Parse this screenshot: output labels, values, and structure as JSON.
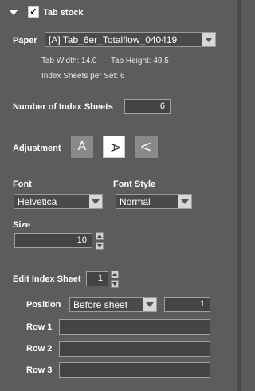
{
  "section": {
    "title": "Tab stock",
    "checked": true
  },
  "paper": {
    "label": "Paper",
    "selected": "[A] Tab_6er_Totalflow_040419",
    "tab_width": "Tab Width: 14.0",
    "tab_height": "Tab Height: 49.5",
    "index_sheets_per_set": "Index Sheets per Set: 6"
  },
  "number_of_index_sheets": {
    "label": "Number of Index Sheets",
    "value": "6"
  },
  "adjustment": {
    "label": "Adjustment",
    "options": [
      {
        "name": "adjust-normal-icon",
        "glyph": "A",
        "active": false
      },
      {
        "name": "adjust-rotate-right-icon",
        "glyph": "A",
        "active": true
      },
      {
        "name": "adjust-rotate-left-icon",
        "glyph": "A",
        "active": false
      }
    ]
  },
  "font": {
    "label": "Font",
    "selected": "Helvetica"
  },
  "font_style": {
    "label": "Font Style",
    "selected": "Normal"
  },
  "size": {
    "label": "Size",
    "value": "10"
  },
  "edit_index_sheet": {
    "label": "Edit Index Sheet",
    "value": "1"
  },
  "position": {
    "label": "Position",
    "selected": "Before sheet",
    "value": "1"
  },
  "rows": [
    {
      "label": "Row 1",
      "value": ""
    },
    {
      "label": "Row 2",
      "value": ""
    },
    {
      "label": "Row 3",
      "value": ""
    }
  ],
  "colors": {
    "background": "#5c5c5c",
    "active_button": "#ffffff",
    "inactive_button": "#8a8a8a"
  }
}
